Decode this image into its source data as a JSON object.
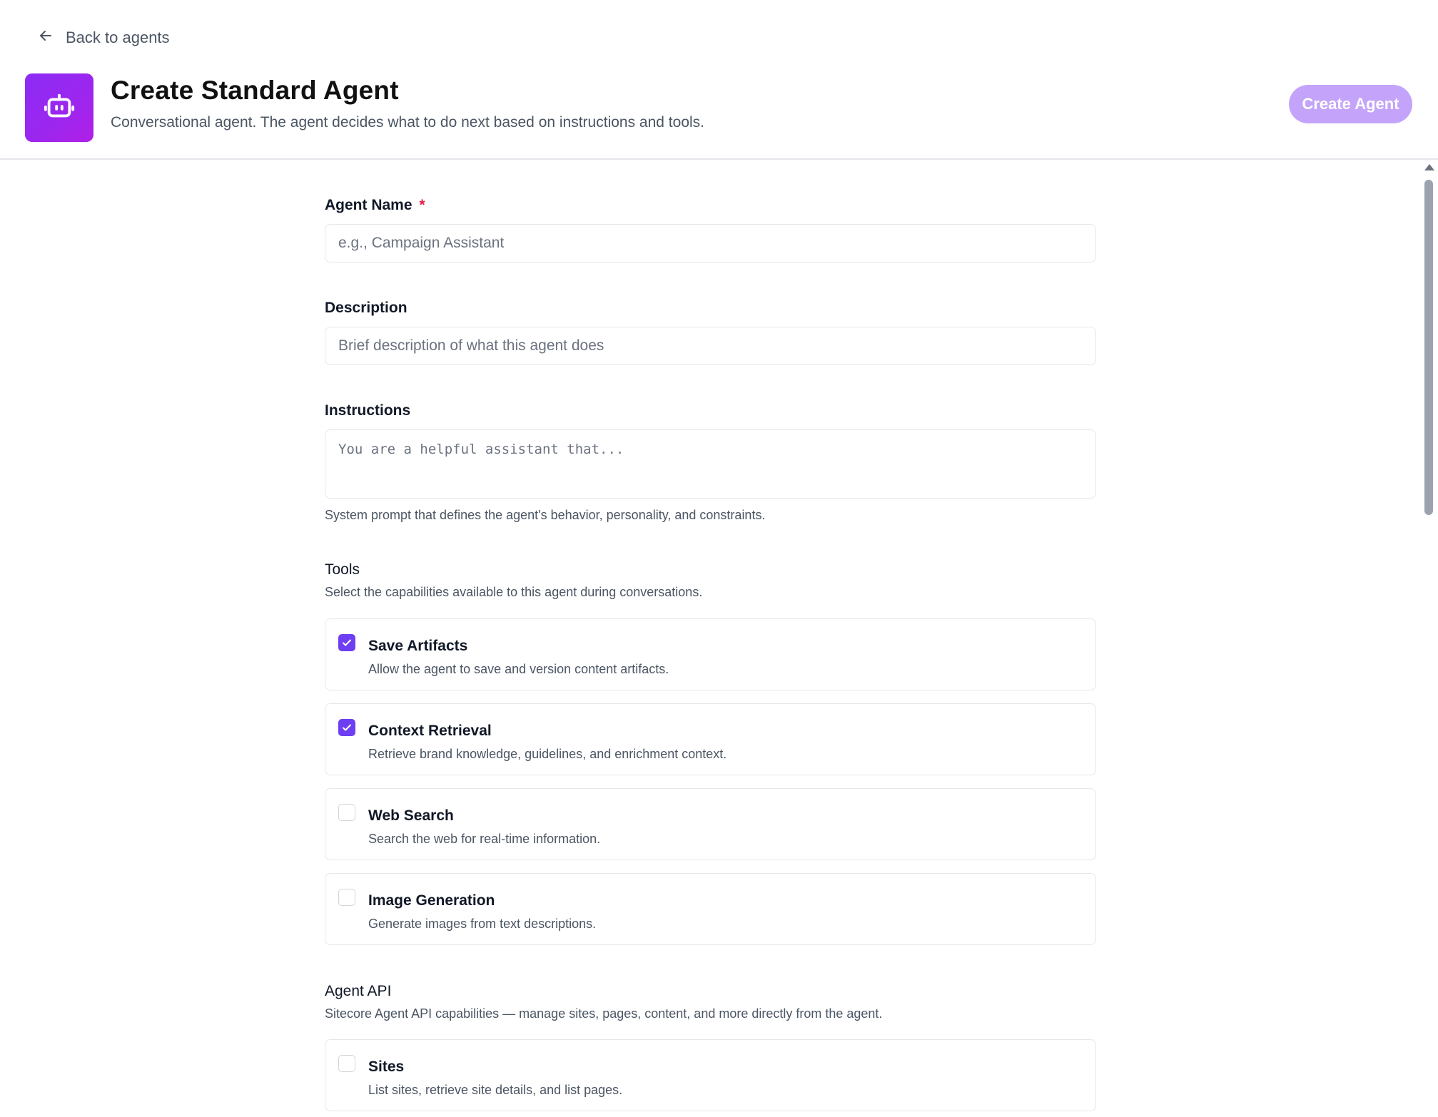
{
  "header": {
    "back_label": "Back to agents",
    "title": "Create Standard Agent",
    "subtitle": "Conversational agent. The agent decides what to do next based on instructions and tools.",
    "create_button_label": "Create Agent",
    "tile_icon": "robot-icon",
    "accent_color": "#9d26ee",
    "button_color": "#c4a4fa"
  },
  "form": {
    "agent_name": {
      "label": "Agent Name",
      "required_mark": "*",
      "placeholder": "e.g., Campaign Assistant",
      "value": ""
    },
    "description": {
      "label": "Description",
      "placeholder": "Brief description of what this agent does",
      "value": ""
    },
    "instructions": {
      "label": "Instructions",
      "placeholder": "You are a helpful assistant that...",
      "help": "System prompt that defines the agent's behavior, personality, and constraints."
    }
  },
  "tools": {
    "title": "Tools",
    "subtitle": "Select the capabilities available to this agent during conversations.",
    "items": [
      {
        "name": "Save Artifacts",
        "description": "Allow the agent to save and version content artifacts.",
        "checked": true
      },
      {
        "name": "Context Retrieval",
        "description": "Retrieve brand knowledge, guidelines, and enrichment context.",
        "checked": true
      },
      {
        "name": "Web Search",
        "description": "Search the web for real-time information.",
        "checked": false
      },
      {
        "name": "Image Generation",
        "description": "Generate images from text descriptions.",
        "checked": false
      }
    ]
  },
  "agent_api": {
    "title": "Agent API",
    "subtitle": "Sitecore Agent API capabilities — manage sites, pages, content, and more directly from the agent.",
    "items": [
      {
        "name": "Sites",
        "description": "List sites, retrieve site details, and list pages.",
        "checked": false
      }
    ]
  },
  "checkbox_checked_color": "#6d3ef2"
}
